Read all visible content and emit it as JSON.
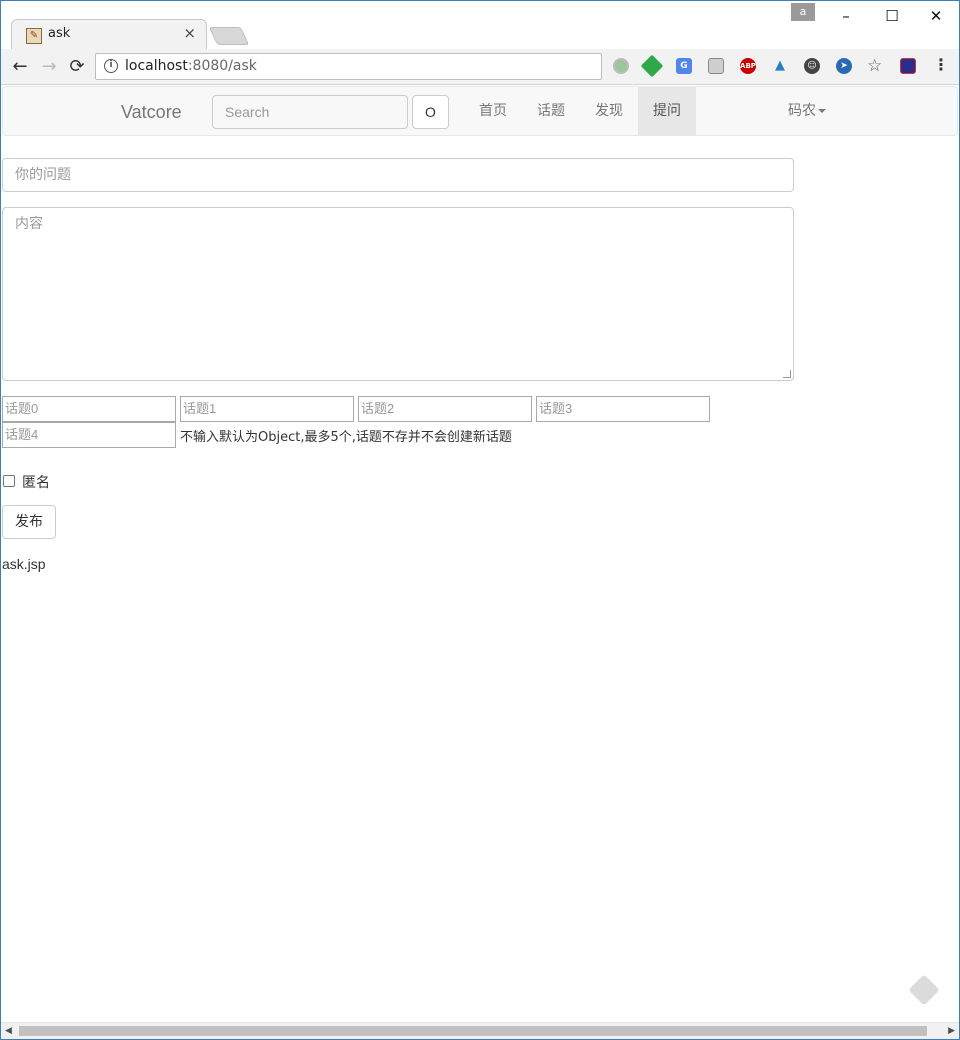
{
  "browser": {
    "tab_title": "ask",
    "tab_close": "×",
    "profile_badge": "a",
    "window_controls": {
      "minimize": "–",
      "maximize": "☐",
      "close": "✕"
    },
    "url_host": "localhost",
    "url_rest": ":8080/ask",
    "nav": {
      "back": "←",
      "forward": "→",
      "reload": "⟳"
    },
    "extensions": [
      "circle-ext-icon",
      "feedly-ext-icon",
      "translate-ext-icon",
      "mail-ext-icon",
      "adblock-ext-icon",
      "chart-ext-icon",
      "github-ext-icon",
      "bird-ext-icon",
      "bookmark-star-icon",
      "flag-ext-icon"
    ],
    "abp_label": "ABP",
    "star_glyph": "☆",
    "menu_glyph": "⋮"
  },
  "navbar": {
    "brand": "Vatcore",
    "search_placeholder": "Search",
    "search_button": "O",
    "links": [
      "首页",
      "话题",
      "发现",
      "提问"
    ],
    "active_link": "提问",
    "user_menu": "码农"
  },
  "form": {
    "question_placeholder": "你的问题",
    "content_placeholder": "内容",
    "topic_placeholders": [
      "话题0",
      "话题1",
      "话题2",
      "话题3",
      "话题4"
    ],
    "topic_hint": "不输入默认为Object,最多5个,话题不存并不会创建新话题",
    "anonymous_label": "匿名",
    "anonymous_checked": false,
    "publish_button": "发布"
  },
  "footer": {
    "page_name": "ask.jsp"
  },
  "colors": {
    "navbar_bg": "#f8f8f8",
    "active_link_bg": "#e7e7e7",
    "window_border": "#3c7fb1"
  }
}
